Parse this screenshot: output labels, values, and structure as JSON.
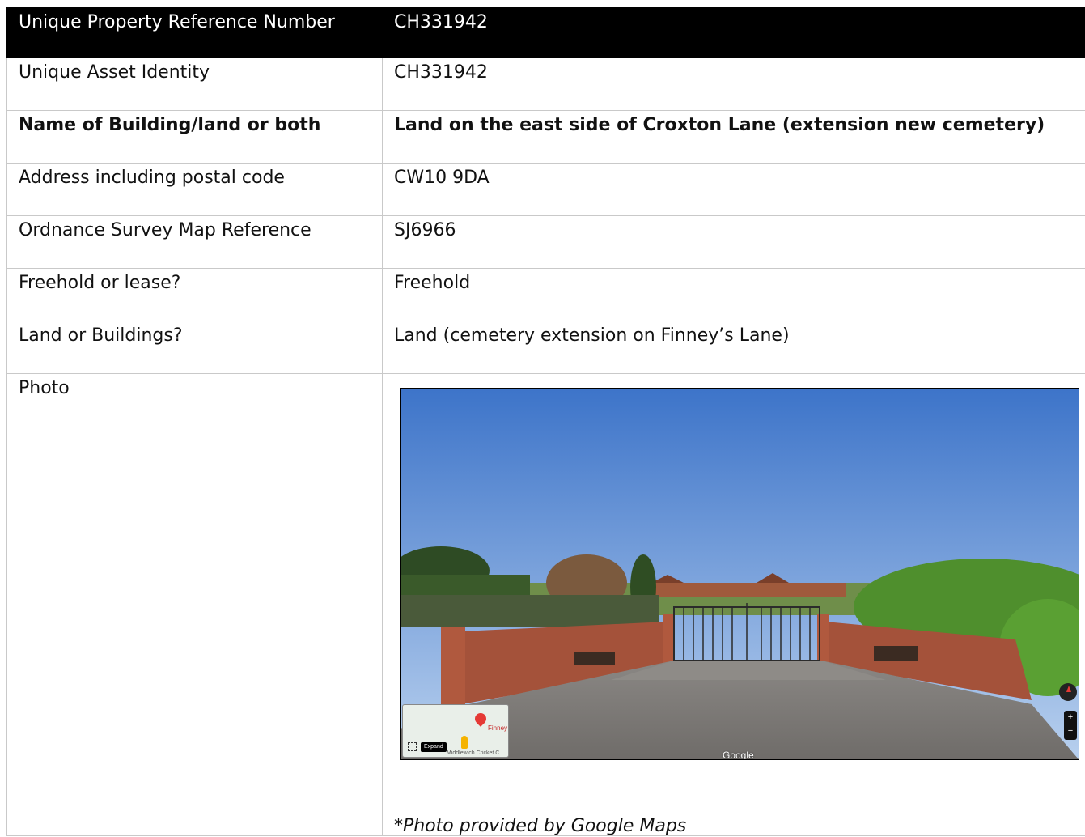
{
  "rows": [
    {
      "label": "Unique Property Reference Number",
      "value": "CH331942"
    },
    {
      "label": "Unique Asset Identity",
      "value": "CH331942"
    },
    {
      "label": "Name of Building/land or both",
      "value": "Land on the east side of Croxton Lane (extension new cemetery)"
    },
    {
      "label": "Address including postal code",
      "value": "CW10 9DA"
    },
    {
      "label": "Ordnance Survey Map Reference",
      "value": "SJ6966"
    },
    {
      "label": "Freehold or lease?",
      "value": "Freehold"
    },
    {
      "label": "Land or Buildings?",
      "value": "Land (cemetery extension on Finney’s Lane)"
    }
  ],
  "photo": {
    "label": "Photo",
    "caption": "*Photo provided by Google Maps",
    "minimap": {
      "expand_label": "Expand",
      "pin_label": "Finney",
      "place_label": "Middlewich Cricket C"
    },
    "watermark": "Google",
    "zoom_in": "+",
    "zoom_out": "−"
  },
  "colors": {
    "header_bg": "#000000",
    "header_text": "#ffffff",
    "border": "#c9c9c9"
  }
}
